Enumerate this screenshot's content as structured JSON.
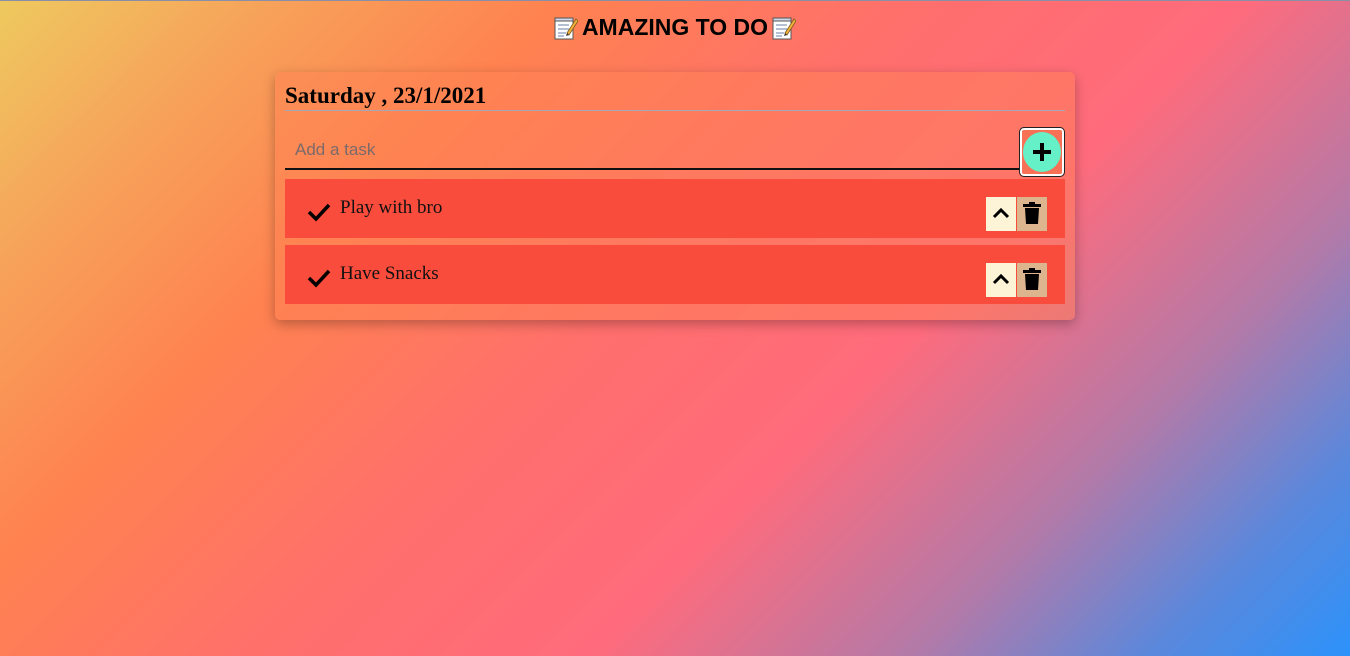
{
  "app": {
    "title": "AMAZING TO DO",
    "title_icon": "memo-icon"
  },
  "card": {
    "date": "Saturday , 23/1/2021"
  },
  "input": {
    "placeholder": "Add a task",
    "value": "",
    "add_icon": "plus-icon",
    "add_button_color": "#66f0c8"
  },
  "tasks": [
    {
      "text": "Play with bro",
      "check_icon": "check-icon",
      "up_icon": "chevron-up-icon",
      "delete_icon": "trash-icon"
    },
    {
      "text": "Have Snacks",
      "check_icon": "check-icon",
      "up_icon": "chevron-up-icon",
      "delete_icon": "trash-icon"
    }
  ],
  "colors": {
    "task_background": "#f94c3c",
    "up_button": "#fdf4d8",
    "delete_button": "#dcb48e"
  }
}
